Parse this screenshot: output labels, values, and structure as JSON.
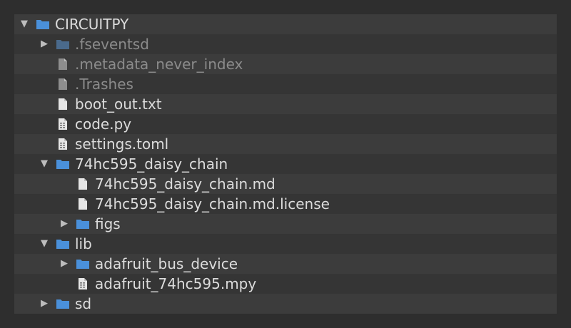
{
  "colors": {
    "folder": "#4a90d9",
    "folder_dim": "#4a6a8c",
    "file": "#e6e6e6",
    "file_dim": "#8e8e8e",
    "text": "#dcdcdc",
    "text_dim": "#8b8b8b"
  },
  "tree": {
    "rows": [
      {
        "label": "CIRCUITPY",
        "depth": 0,
        "kind": "folder",
        "toggle": "expanded",
        "dim": false
      },
      {
        "label": ".fseventsd",
        "depth": 1,
        "kind": "folder",
        "toggle": "collapsed",
        "dim": true
      },
      {
        "label": ".metadata_never_index",
        "depth": 1,
        "kind": "file",
        "toggle": "none",
        "dim": true
      },
      {
        "label": ".Trashes",
        "depth": 1,
        "kind": "file",
        "toggle": "none",
        "dim": true
      },
      {
        "label": "boot_out.txt",
        "depth": 1,
        "kind": "file",
        "toggle": "none",
        "dim": false
      },
      {
        "label": "code.py",
        "depth": 1,
        "kind": "code",
        "toggle": "none",
        "dim": false
      },
      {
        "label": "settings.toml",
        "depth": 1,
        "kind": "code",
        "toggle": "none",
        "dim": false
      },
      {
        "label": "74hc595_daisy_chain",
        "depth": 1,
        "kind": "folder",
        "toggle": "expanded",
        "dim": false
      },
      {
        "label": "74hc595_daisy_chain.md",
        "depth": 2,
        "kind": "file",
        "toggle": "none",
        "dim": false
      },
      {
        "label": "74hc595_daisy_chain.md.license",
        "depth": 2,
        "kind": "file",
        "toggle": "none",
        "dim": false
      },
      {
        "label": "figs",
        "depth": 2,
        "kind": "folder",
        "toggle": "collapsed",
        "dim": false
      },
      {
        "label": "lib",
        "depth": 1,
        "kind": "folder",
        "toggle": "expanded",
        "dim": false
      },
      {
        "label": "adafruit_bus_device",
        "depth": 2,
        "kind": "folder",
        "toggle": "collapsed",
        "dim": false
      },
      {
        "label": "adafruit_74hc595.mpy",
        "depth": 2,
        "kind": "code",
        "toggle": "none",
        "dim": false
      },
      {
        "label": "sd",
        "depth": 1,
        "kind": "folder",
        "toggle": "collapsed",
        "dim": false
      }
    ]
  }
}
